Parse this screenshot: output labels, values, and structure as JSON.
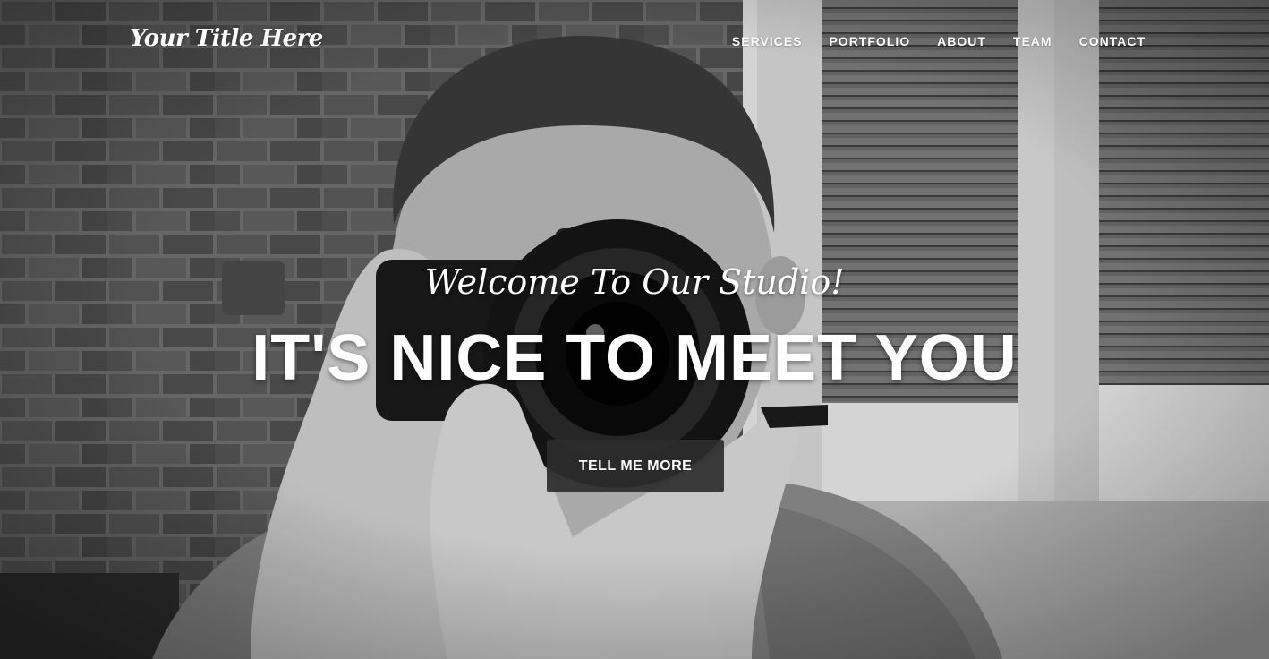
{
  "brand": {
    "title": "Your Title Here"
  },
  "nav": {
    "items": [
      {
        "label": "SERVICES"
      },
      {
        "label": "PORTFOLIO"
      },
      {
        "label": "ABOUT"
      },
      {
        "label": "TEAM"
      },
      {
        "label": "CONTACT"
      }
    ]
  },
  "hero": {
    "lead": "Welcome To Our Studio!",
    "heading": "IT'S NICE TO MEET YOU",
    "cta_label": "TELL ME MORE",
    "image": "black-and-white-photo-photographer-with-camera"
  },
  "colors": {
    "text": "#ffffff",
    "button_bg": "#2d2d2d"
  }
}
